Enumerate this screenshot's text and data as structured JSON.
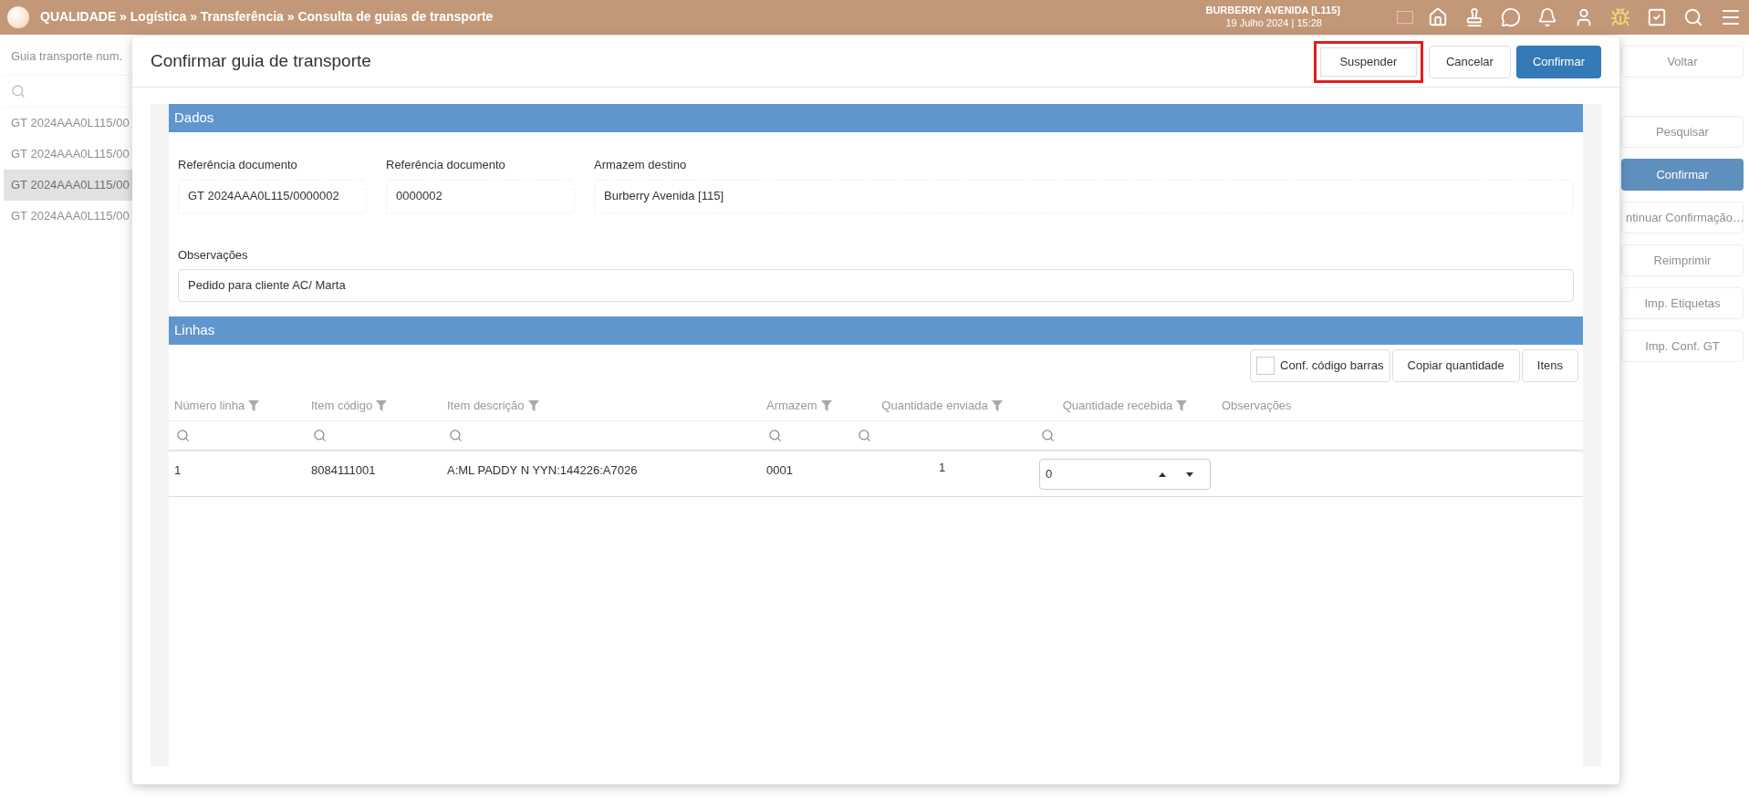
{
  "top_bar": {
    "breadcrumb": "QUALIDADE » Logística » Transferência » Consulta de guias de transporte",
    "store": "BURBERRY AVENIDA [L115]",
    "datetime": "19 Julho 2024 | 15:28"
  },
  "list_panel": {
    "column": "Guia transporte num.",
    "rows": [
      {
        "text": "GT 2024AAA0L115/00",
        "selected": false
      },
      {
        "text": "GT 2024AAA0L115/00",
        "selected": false
      },
      {
        "text": "GT 2024AAA0L115/00",
        "selected": true
      },
      {
        "text": "GT 2024AAA0L115/00",
        "selected": false
      }
    ]
  },
  "side_buttons": [
    {
      "label": "Voltar",
      "kind": "default"
    },
    {
      "label": "Pesquisar",
      "kind": "default"
    },
    {
      "label": "Confirmar",
      "kind": "primary"
    },
    {
      "label": "ntinuar Confirmação…",
      "kind": "default"
    },
    {
      "label": "Reimprimir",
      "kind": "default"
    },
    {
      "label": "Imp. Etiquetas",
      "kind": "default"
    },
    {
      "label": "Imp. Conf. GT",
      "kind": "default"
    }
  ],
  "dialog": {
    "title": "Confirmar guia de transporte",
    "actions": [
      {
        "label": "Suspender",
        "kind": "default",
        "highlighted": true
      },
      {
        "label": "Cancelar",
        "kind": "default",
        "highlighted": false
      },
      {
        "label": "Confirmar",
        "kind": "primary",
        "highlighted": false
      }
    ],
    "data_section": {
      "title": "Dados",
      "fields": [
        {
          "label": "Referência documento",
          "value": "GT 2024AAA0L115/0000002"
        },
        {
          "label": "Referência documento",
          "value": "0000002"
        },
        {
          "label": "Armazem destino",
          "value": "Burberry Avenida [115]"
        }
      ],
      "notes": {
        "label": "Observações",
        "value": "Pedido para cliente AC/ Marta"
      }
    },
    "lines_section": {
      "title": "Linhas",
      "barcode_check": {
        "label": "Conf. código barras",
        "checked": false
      },
      "buttons": [
        "Copiar quantidade",
        "Itens"
      ],
      "columns": [
        {
          "label": "Número linha",
          "filter": true,
          "search": true
        },
        {
          "label": "Item código",
          "filter": true,
          "search": true
        },
        {
          "label": "Item descrição",
          "filter": true,
          "search": true
        },
        {
          "label": "Armazem",
          "filter": true,
          "search": true
        },
        {
          "label": "Quantidade enviada",
          "filter": true,
          "search": true
        },
        {
          "label": "Quantidade recebida",
          "filter": true,
          "search": true
        },
        {
          "label": "Observações",
          "filter": false,
          "search": false
        }
      ],
      "rows": [
        {
          "cells": [
            "1",
            "8084111001",
            "A:ML PADDY N YYN:144226:A7026",
            "0001",
            "1"
          ],
          "received": "0"
        }
      ]
    }
  }
}
